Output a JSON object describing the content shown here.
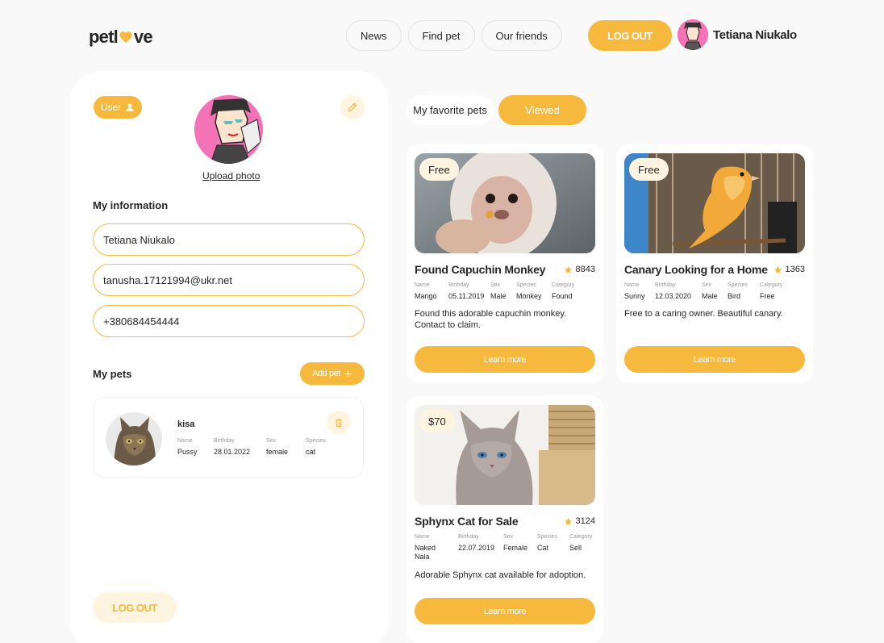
{
  "header": {
    "logo_left": "petl",
    "logo_right": "ve",
    "nav": [
      "News",
      "Find pet",
      "Our friends"
    ],
    "logout_label": "LOG OUT",
    "user_name": "Tetiana Niukalo"
  },
  "profile": {
    "badge_label": "User",
    "upload_label": "Upload photo",
    "info_title": "My information",
    "name": "Tetiana Niukalo",
    "email": "tanusha.17121994@ukr.net",
    "phone": "+380684454444",
    "pets_title": "My pets",
    "add_pet_label": "Add pet",
    "logout_label": "LOG OUT"
  },
  "my_pet": {
    "title": "kisa",
    "labels": [
      "Name",
      "Birthday",
      "Sex",
      "Species"
    ],
    "values": [
      "Pussy",
      "28.01.2022",
      "female",
      "cat"
    ]
  },
  "tabs": {
    "favorites": "My favorite pets",
    "viewed": "Viewed"
  },
  "notices": [
    {
      "price": "Free",
      "title": "Found Capuchin Monkey",
      "popularity": "8843",
      "labels": [
        "Name",
        "Birthday",
        "Sex",
        "Species",
        "Category"
      ],
      "values": [
        "Mango",
        "05.11.2019",
        "Male",
        "Monkey",
        "Found"
      ],
      "comment": "Found this adorable capuchin monkey. Contact to claim.",
      "button": "Learn more"
    },
    {
      "price": "Free",
      "title": "Canary Looking for a Home",
      "popularity": "1363",
      "labels": [
        "Name",
        "Birthday",
        "Sex",
        "Species",
        "Category"
      ],
      "values": [
        "Sunny",
        "12.03.2020",
        "Male",
        "Bird",
        "Free"
      ],
      "comment": "Free to a caring owner. Beautiful canary.",
      "button": "Learn more"
    },
    {
      "price": "$70",
      "title": "Sphynx Cat for Sale",
      "popularity": "3124",
      "labels": [
        "Name",
        "Birthday",
        "Sex",
        "Species",
        "Category"
      ],
      "values": [
        "Naked Nala",
        "22.07.2019",
        "Female",
        "Cat",
        "Sell"
      ],
      "comment": "Adorable Sphynx cat available for adoption.",
      "button": "Learn more"
    }
  ],
  "colors": {
    "accent": "#f6b83d",
    "accent_light": "#fff4df",
    "text": "#262626",
    "background": "#f9f9f9"
  }
}
